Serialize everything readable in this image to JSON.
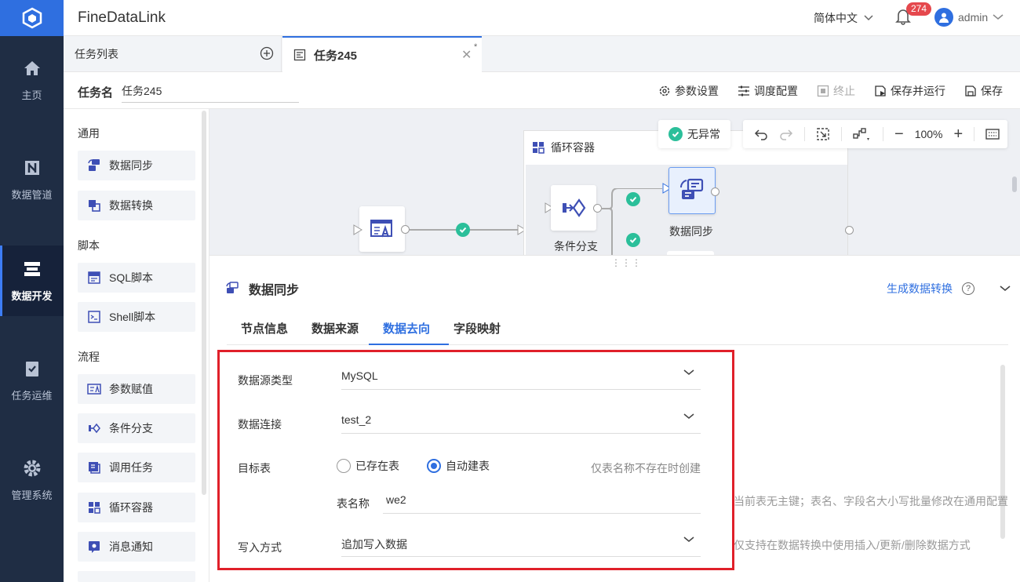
{
  "app": {
    "title": "FineDataLink",
    "language": "简体中文",
    "notifications": "274",
    "user": "admin"
  },
  "sidebar": {
    "items": [
      {
        "label": "主页",
        "icon": "home-icon"
      },
      {
        "label": "数据管道",
        "icon": "pipeline-icon"
      },
      {
        "label": "数据开发",
        "icon": "dev-icon"
      },
      {
        "label": "任务运维",
        "icon": "ops-icon"
      },
      {
        "label": "管理系统",
        "icon": "gear-icon"
      }
    ]
  },
  "tabs": {
    "list_label": "任务列表",
    "active_task": "任务245",
    "unsaved_mark": "*"
  },
  "task": {
    "label": "任务名",
    "name": "任务245",
    "toolbar": {
      "params": "参数设置",
      "schedule": "调度配置",
      "stop": "终止",
      "save_run": "保存并运行",
      "save": "保存"
    }
  },
  "palette": {
    "sections": {
      "general": "通用",
      "script": "脚本",
      "flow": "流程"
    },
    "items": {
      "sync": "数据同步",
      "transform": "数据转换",
      "sql": "SQL脚本",
      "shell": "Shell脚本",
      "assign": "参数赋值",
      "branch": "条件分支",
      "call": "调用任务",
      "loop": "循环容器",
      "notify": "消息通知"
    }
  },
  "canvas": {
    "status": "无异常",
    "zoom": "100%",
    "loop_title": "循环容器",
    "nodes": {
      "branch": "条件分支",
      "sync": "数据同步"
    }
  },
  "panel": {
    "title": "数据同步",
    "generate_link": "生成数据转换",
    "help": "?",
    "tabs": [
      "节点信息",
      "数据来源",
      "数据去向",
      "字段映射"
    ],
    "form": {
      "source_type_label": "数据源类型",
      "source_type": "MySQL",
      "connection_label": "数据连接",
      "connection": "test_2",
      "target_label": "目标表",
      "radio_existing": "已存在表",
      "radio_auto": "自动建表",
      "auto_hint": "仅表名称不存在时创建",
      "table_name_label": "表名称",
      "table_name": "we2",
      "write_label": "写入方式",
      "write_mode": "追加写入数据",
      "side_hint_1": "当前表无主键；表名、字段名大小写批量修改在通用配置",
      "side_hint_2": "仅支持在数据转换中使用插入/更新/删除数据方式"
    }
  }
}
